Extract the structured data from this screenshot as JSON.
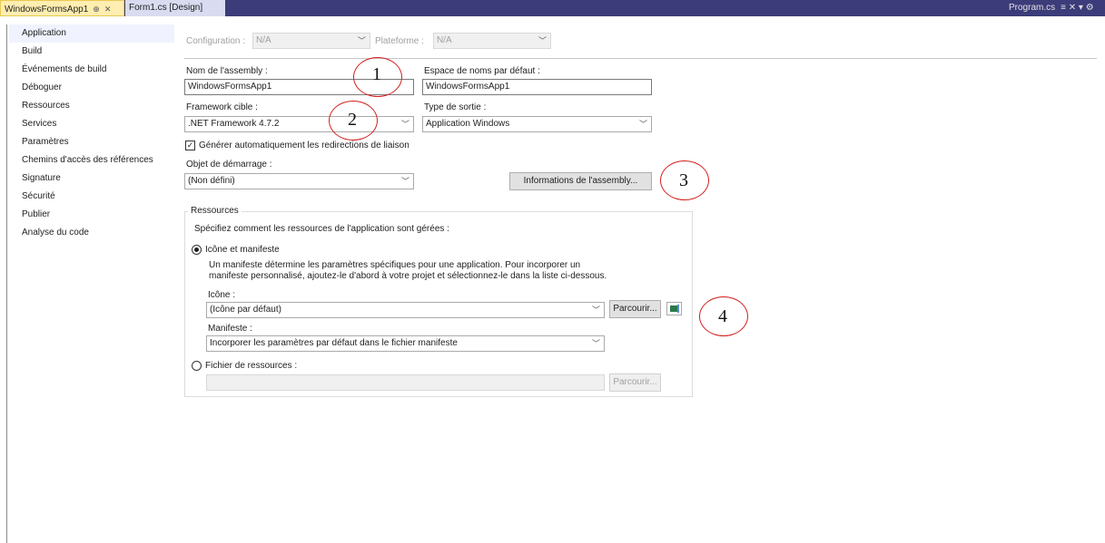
{
  "tabs": {
    "active_label": "WindowsFormsApp1",
    "active_pin": "⊕",
    "active_close": "✕",
    "second_label": "Form1.cs [Design]",
    "right_label": "Program.cs",
    "right_controls": "≡ ✕ ▾ ⚙"
  },
  "sidebar": {
    "items": [
      {
        "label": "Application"
      },
      {
        "label": "Build"
      },
      {
        "label": "Événements de build"
      },
      {
        "label": "Déboguer"
      },
      {
        "label": "Ressources"
      },
      {
        "label": "Services"
      },
      {
        "label": "Paramètres"
      },
      {
        "label": "Chemins d'accès des références"
      },
      {
        "label": "Signature"
      },
      {
        "label": "Sécurité"
      },
      {
        "label": "Publier"
      },
      {
        "label": "Analyse du code"
      }
    ]
  },
  "config": {
    "configuration_label": "Configuration :",
    "configuration_value": "N/A",
    "platform_label": "Plateforme :",
    "platform_value": "N/A"
  },
  "form": {
    "assembly_label": "Nom de l'assembly :",
    "assembly_value": "WindowsFormsApp1",
    "namespace_label": "Espace de noms par défaut :",
    "namespace_value": "WindowsFormsApp1",
    "framework_label": "Framework cible :",
    "framework_value": ".NET Framework 4.7.2",
    "output_label": "Type de sortie :",
    "output_value": "Application Windows",
    "autogen_label": "Générer automatiquement les redirections de liaison",
    "autogen_checked": "✓",
    "startup_label": "Objet de démarrage :",
    "startup_value": "(Non défini)",
    "assembly_info_button": "Informations de l'assembly..."
  },
  "resources": {
    "group_title": "Ressources",
    "intro": "Spécifiez comment les ressources de l'application sont gérées :",
    "icon_manifest_label": "Icône et manifeste",
    "desc_line1": "Un manifeste détermine les paramètres spécifiques pour une application. Pour incorporer un",
    "desc_line2": "manifeste personnalisé, ajoutez-le d'abord à votre projet et sélectionnez-le dans la liste ci-dessous.",
    "icon_label": "Icône :",
    "icon_value": "(Icône par défaut)",
    "browse_label": "Parcourir...",
    "manifest_label": "Manifeste :",
    "manifest_value": "Incorporer les paramètres par défaut dans le fichier manifeste",
    "resource_file_label": "Fichier de ressources :",
    "browse2_label": "Parcourir..."
  },
  "annotations": [
    "1",
    "2",
    "3",
    "4"
  ],
  "icons": {
    "caret": "﹀"
  },
  "colors": {
    "tab_strip": "#3c3c7a",
    "active_tab": "#ffeeb0",
    "annotation_circle": "#d42020"
  }
}
